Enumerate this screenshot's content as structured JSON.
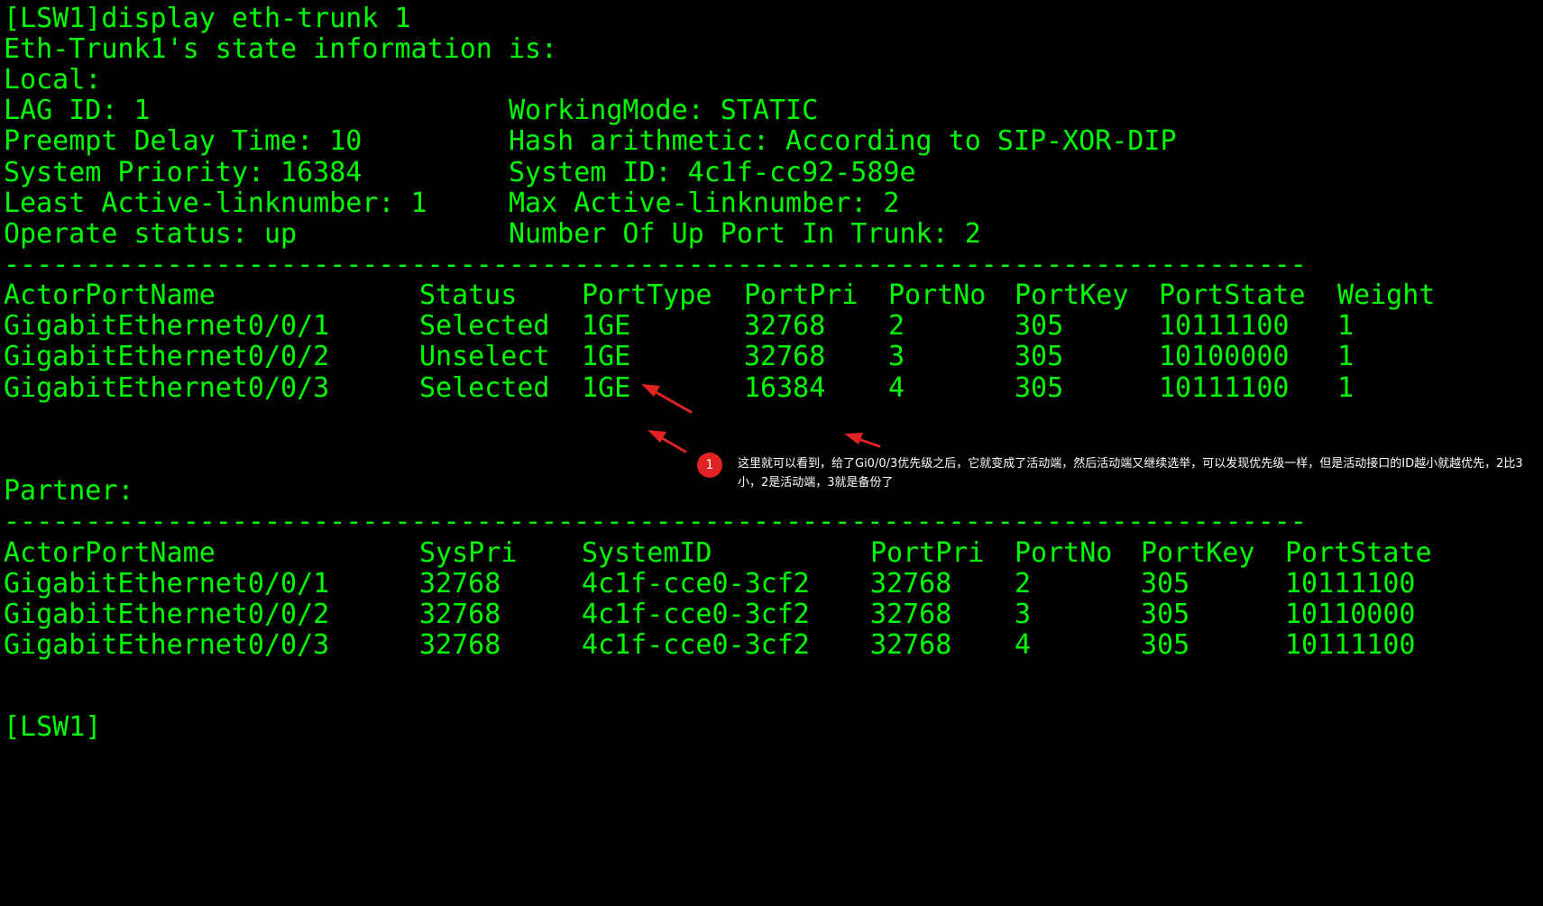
{
  "colors": {
    "background": "#000000",
    "terminal_text": "#00ff00",
    "annotation_accent": "#e02424",
    "annotation_text": "#ffffff"
  },
  "terminal": {
    "command_line": "[LSW1]display eth-trunk 1",
    "state_header": "Eth-Trunk1's state information is:",
    "local_label": "Local:",
    "local_info": [
      {
        "left": "LAG ID: 1",
        "right": "WorkingMode: STATIC"
      },
      {
        "left": "Preempt Delay Time: 10",
        "right": "Hash arithmetic: According to SIP-XOR-DIP"
      },
      {
        "left": "System Priority: 16384",
        "right": "System ID: 4c1f-cc92-589e"
      },
      {
        "left": "Least Active-linknumber: 1",
        "right": "Max Active-linknumber: 2"
      },
      {
        "left": "Operate status: up",
        "right": "Number Of Up Port In Trunk: 2"
      }
    ],
    "divider": "--------------------------------------------------------------------------------",
    "actor_table": {
      "headers": [
        "ActorPortName",
        "Status",
        "PortType",
        "PortPri",
        "PortNo",
        "PortKey",
        "PortState",
        "Weight"
      ],
      "rows": [
        [
          "GigabitEthernet0/0/1",
          "Selected",
          "1GE",
          "32768",
          "2",
          "305",
          "10111100",
          "1"
        ],
        [
          "GigabitEthernet0/0/2",
          "Unselect",
          "1GE",
          "32768",
          "3",
          "305",
          "10100000",
          "1"
        ],
        [
          "GigabitEthernet0/0/3",
          "Selected",
          "1GE",
          "16384",
          "4",
          "305",
          "10111100",
          "1"
        ]
      ]
    },
    "partner_label": "Partner:",
    "partner_table": {
      "headers": [
        "ActorPortName",
        "SysPri",
        "SystemID",
        "PortPri",
        "PortNo",
        "PortKey",
        "PortState"
      ],
      "rows": [
        [
          "GigabitEthernet0/0/1",
          "32768",
          "4c1f-cce0-3cf2",
          "32768",
          "2",
          "305",
          "10111100"
        ],
        [
          "GigabitEthernet0/0/2",
          "32768",
          "4c1f-cce0-3cf2",
          "32768",
          "3",
          "305",
          "10110000"
        ],
        [
          "GigabitEthernet0/0/3",
          "32768",
          "4c1f-cce0-3cf2",
          "32768",
          "4",
          "305",
          "10111100"
        ]
      ]
    },
    "prompt": "[LSW1]"
  },
  "annotation": {
    "badge": "1",
    "text": "这里就可以看到，给了Gi0/0/3优先级之后，它就变成了活动端，然后活动端又继续选举，可以发现优先级一样，但是活动接口的ID越小就越优先，2比3小，2是活动端，3就是备份了"
  }
}
